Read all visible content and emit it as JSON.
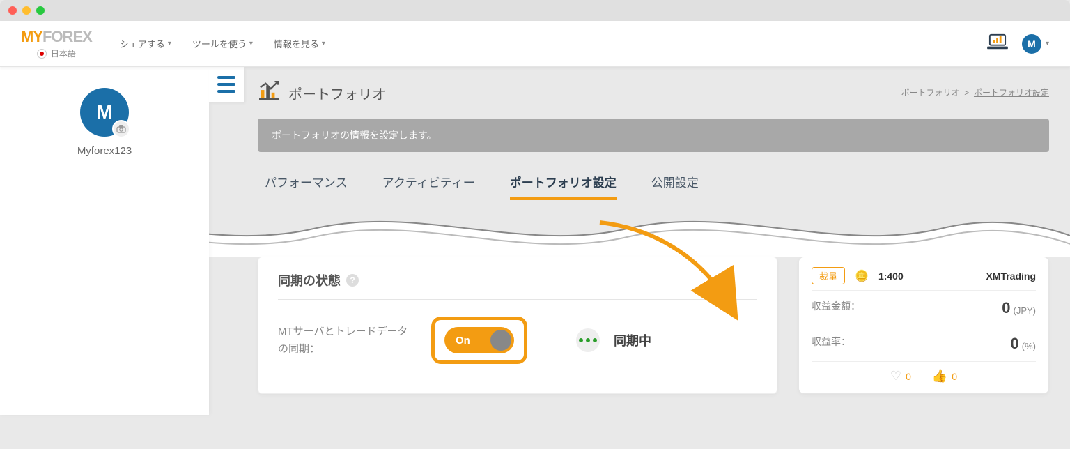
{
  "header": {
    "logo_my": "MY",
    "logo_forex": "FOREX",
    "language": "日本語",
    "nav": [
      "シェアする",
      "ツールを使う",
      "情報を見る"
    ],
    "avatar_letter": "M"
  },
  "sidebar": {
    "avatar_letter": "M",
    "username": "Myforex123"
  },
  "page": {
    "title": "ポートフォリオ",
    "breadcrumb_root": "ポートフォリオ",
    "breadcrumb_sep": ">",
    "breadcrumb_current": "ポートフォリオ設定",
    "info_banner": "ポートフォリオの情報を設定します。"
  },
  "tabs": [
    "パフォーマンス",
    "アクティビティー",
    "ポートフォリオ設定",
    "公開設定"
  ],
  "active_tab_index": 2,
  "sync": {
    "section_title": "同期の状態",
    "label": "MTサーバとトレードデータの同期：",
    "toggle_text": "On",
    "status_text": "同期中"
  },
  "account_card": {
    "badge": "裁量",
    "leverage": "1:400",
    "broker": "XMTrading",
    "profit_label": "収益金額：",
    "profit_value": "0",
    "profit_unit": "(JPY)",
    "rate_label": "収益率：",
    "rate_value": "0",
    "rate_unit": "(%)",
    "like_count": "0",
    "fav_count": "0"
  }
}
